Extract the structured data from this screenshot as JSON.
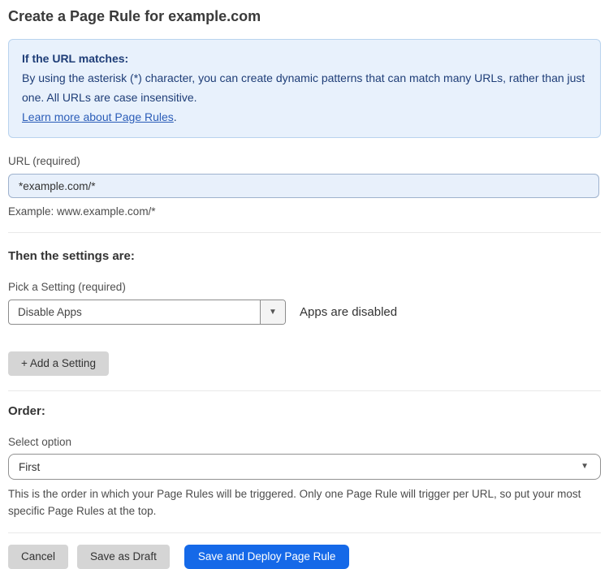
{
  "page": {
    "title": "Create a Page Rule for example.com"
  },
  "info_box": {
    "heading": "If the URL matches:",
    "body": "By using the asterisk (*) character, you can create dynamic patterns that can match many URLs, rather than just one. All URLs are case insensitive.",
    "link_label": "Learn more about Page Rules",
    "link_suffix": "."
  },
  "url_section": {
    "label": "URL (required)",
    "value": "*example.com/*",
    "example": "Example: www.example.com/*"
  },
  "settings_section": {
    "heading": "Then the settings are:",
    "setting_label": "Pick a Setting (required)",
    "setting_value": "Disable Apps",
    "caret_icon": "▼",
    "setting_status": "Apps are disabled",
    "add_setting_label": "+ Add a Setting"
  },
  "order_section": {
    "heading": "Order:",
    "label": "Select option",
    "value": "First",
    "caret_icon": "▼",
    "help": "This is the order in which your Page Rules will be triggered. Only one Page Rule will trigger per URL, so put your most specific Page Rules at the top."
  },
  "footer": {
    "cancel_label": "Cancel",
    "save_draft_label": "Save as Draft",
    "save_deploy_label": "Save and Deploy Page Rule"
  },
  "colors": {
    "accent_blue": "#1569e8",
    "info_background": "#e8f1fc",
    "info_border": "#b9d3ee",
    "info_text": "#1e3d77",
    "link_blue": "#2b5db8",
    "input_background": "#e8f0fb",
    "button_gray": "#d5d5d5"
  }
}
